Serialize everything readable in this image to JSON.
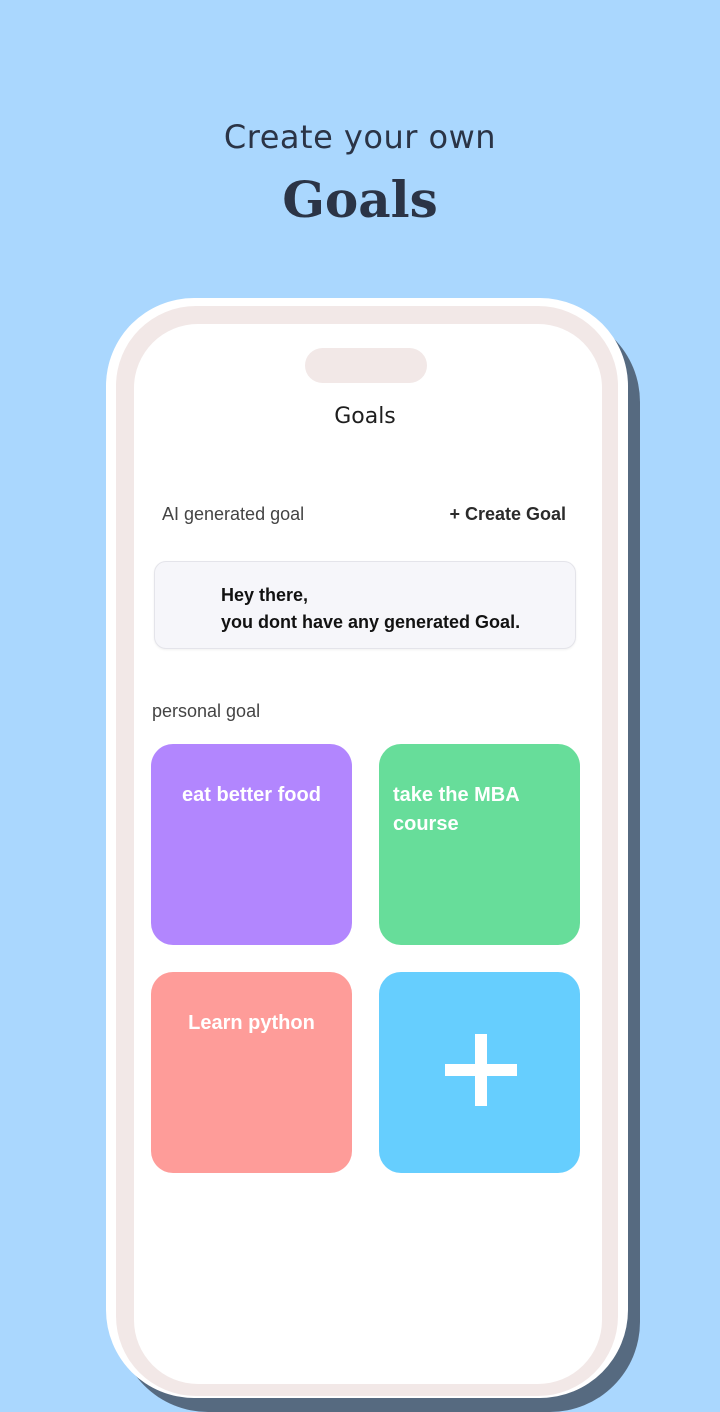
{
  "hero": {
    "subtitle": "Create your own",
    "title": "Goals"
  },
  "screen": {
    "title": "Goals",
    "ai_section": {
      "label": "AI generated goal",
      "create_button": "+ Create Goal",
      "empty_line1": "Hey there,",
      "empty_line2": "you dont have any generated Goal."
    },
    "personal_section": {
      "label": "personal goal",
      "goals": [
        {
          "label": "eat better food",
          "color": "#b286fe"
        },
        {
          "label": "take the MBA course",
          "color": "#67dd9a"
        },
        {
          "label": "Learn python",
          "color": "#fe9c99"
        }
      ],
      "add_tile": {
        "icon": "plus-icon",
        "color": "#66cefe"
      }
    }
  },
  "colors": {
    "background": "#aad7fe",
    "text_dark": "#2b3446"
  }
}
